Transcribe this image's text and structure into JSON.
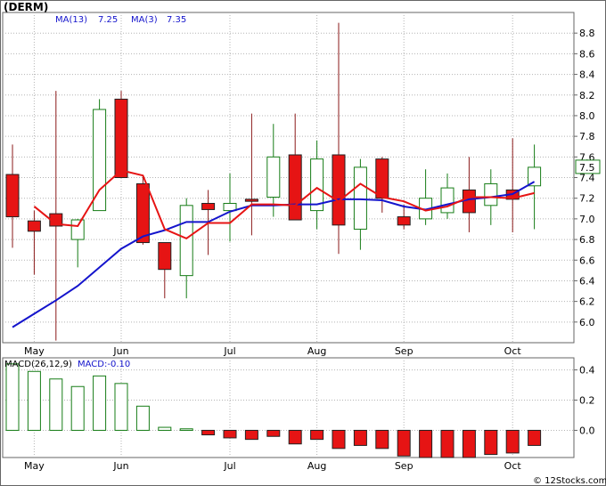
{
  "header": {
    "symbol": "(DERM)",
    "ma13_label": "MA(13)",
    "ma13_value": "7.25",
    "ma3_label": "MA(3)",
    "ma3_value": "7.35",
    "price_tag": "7.5",
    "macd_label": "MACD(26,12,9)",
    "macd_value_label": "MACD:-0.10",
    "watermark": "© 12Stocks.com"
  },
  "colors": {
    "up_candle": "#167c16",
    "down_candle": "#e61414",
    "ma13": "#1414cc",
    "ma3": "#e61414",
    "grid": "#b4b4b4",
    "price_tag_border": "#167c16"
  },
  "chart_data": [
    {
      "type": "candlestick",
      "months": [
        "May",
        "Jun",
        "Jul",
        "Aug",
        "Sep",
        "Oct"
      ],
      "month_positions": [
        1.5,
        5.5,
        10.5,
        14.5,
        18.5,
        23.5
      ],
      "ylim": [
        5.8,
        9.0
      ],
      "yticks": [
        6.0,
        6.2,
        6.4,
        6.6,
        6.8,
        7.0,
        7.2,
        7.4,
        7.6,
        7.8,
        8.0,
        8.2,
        8.4,
        8.6,
        8.8
      ],
      "ytick_labels": [
        "6.0",
        "6.2",
        "6.4",
        "6.6",
        "6.8",
        "7.0",
        "7.2",
        "7.4",
        "7.6",
        "7.8",
        "8.0",
        "8.2",
        "8.4",
        "8.6",
        "8.8"
      ],
      "last_price": 7.5,
      "candles": [
        {
          "open": 7.43,
          "high": 7.72,
          "low": 6.72,
          "close": 7.02
        },
        {
          "open": 6.98,
          "high": 7.08,
          "low": 6.46,
          "close": 6.88
        },
        {
          "open": 7.05,
          "high": 8.24,
          "low": 5.82,
          "close": 6.93
        },
        {
          "open": 6.8,
          "high": 7.0,
          "low": 6.53,
          "close": 6.99
        },
        {
          "open": 7.08,
          "high": 8.16,
          "low": 7.08,
          "close": 8.06
        },
        {
          "open": 8.16,
          "high": 8.24,
          "low": 7.4,
          "close": 7.4
        },
        {
          "open": 7.34,
          "high": 7.42,
          "low": 6.75,
          "close": 6.77
        },
        {
          "open": 6.77,
          "high": 6.77,
          "low": 6.23,
          "close": 6.51
        },
        {
          "open": 6.45,
          "high": 7.2,
          "low": 6.23,
          "close": 7.13
        },
        {
          "open": 7.15,
          "high": 7.28,
          "low": 6.65,
          "close": 7.09
        },
        {
          "open": 7.08,
          "high": 7.44,
          "low": 6.78,
          "close": 7.15
        },
        {
          "open": 7.19,
          "high": 8.02,
          "low": 6.84,
          "close": 7.17
        },
        {
          "open": 7.21,
          "high": 7.92,
          "low": 7.02,
          "close": 7.6
        },
        {
          "open": 7.62,
          "high": 8.02,
          "low": 6.99,
          "close": 6.99
        },
        {
          "open": 7.08,
          "high": 7.76,
          "low": 6.9,
          "close": 7.58
        },
        {
          "open": 7.62,
          "high": 8.9,
          "low": 6.66,
          "close": 6.94
        },
        {
          "open": 6.9,
          "high": 7.58,
          "low": 6.7,
          "close": 7.5
        },
        {
          "open": 7.58,
          "high": 7.6,
          "low": 7.06,
          "close": 7.2
        },
        {
          "open": 7.02,
          "high": 7.14,
          "low": 6.9,
          "close": 6.94
        },
        {
          "open": 7.0,
          "high": 7.48,
          "low": 6.94,
          "close": 7.2
        },
        {
          "open": 7.06,
          "high": 7.44,
          "low": 7.0,
          "close": 7.3
        },
        {
          "open": 7.28,
          "high": 7.6,
          "low": 6.87,
          "close": 7.06
        },
        {
          "open": 7.13,
          "high": 7.48,
          "low": 6.94,
          "close": 7.34
        },
        {
          "open": 7.28,
          "high": 7.78,
          "low": 6.87,
          "close": 7.19
        },
        {
          "open": 7.32,
          "high": 7.72,
          "low": 6.9,
          "close": 7.5
        }
      ],
      "ma3": [
        null,
        7.12,
        6.95,
        6.93,
        7.28,
        7.47,
        7.42,
        6.9,
        6.81,
        6.96,
        6.96,
        7.14,
        7.14,
        7.13,
        7.3,
        7.17,
        7.34,
        7.21,
        7.17,
        7.08,
        7.12,
        7.21,
        7.21,
        7.2,
        7.25
      ],
      "ma13": [
        5.95,
        6.08,
        6.21,
        6.35,
        6.53,
        6.71,
        6.83,
        6.89,
        6.97,
        6.97,
        7.07,
        7.13,
        7.13,
        7.14,
        7.14,
        7.19,
        7.19,
        7.18,
        7.12,
        7.09,
        7.14,
        7.19,
        7.21,
        7.24,
        7.36
      ]
    },
    {
      "type": "bar",
      "title": "MACD(26,12,9)",
      "ylim": [
        -0.18,
        0.48
      ],
      "yticks": [
        0.0,
        0.2,
        0.4
      ],
      "ytick_labels": [
        "0.0",
        "0.2",
        "0.4"
      ],
      "values": [
        0.44,
        0.39,
        0.34,
        0.29,
        0.36,
        0.31,
        0.16,
        0.02,
        0.01,
        -0.03,
        -0.05,
        -0.06,
        -0.04,
        -0.09,
        -0.06,
        -0.12,
        -0.1,
        -0.12,
        -0.17,
        -0.18,
        -0.18,
        -0.18,
        -0.16,
        -0.15,
        -0.1
      ]
    }
  ]
}
